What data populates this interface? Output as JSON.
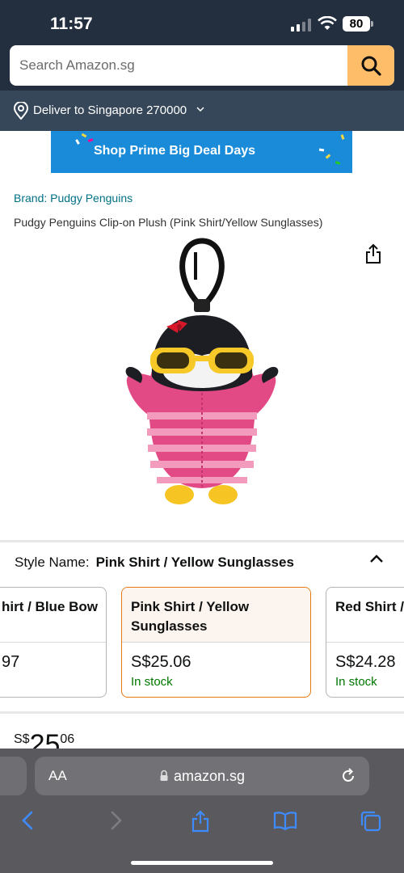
{
  "status_bar": {
    "time": "11:57",
    "battery": "80"
  },
  "search": {
    "placeholder": "Search Amazon.sg"
  },
  "delivery": {
    "text": "Deliver to Singapore 270000"
  },
  "banner": {
    "text": "Shop Prime Big Deal Days"
  },
  "product": {
    "brand": "Brand: Pudgy Penguins",
    "title": "Pudgy Penguins Clip-on Plush (Pink Shirt/Yellow Sunglasses)"
  },
  "style": {
    "label": "Style Name:",
    "selected": "Pink Shirt / Yellow Sunglasses",
    "options": [
      {
        "name": "hirt / Blue Bow",
        "price": "97",
        "stock": ""
      },
      {
        "name": "Pink Shirt / Yellow Sunglasses",
        "price": "S$25.06",
        "stock": "In stock"
      },
      {
        "name": "Red Shirt /",
        "price": "S$24.28",
        "stock": "In stock"
      }
    ]
  },
  "price_peek": {
    "currency": "S$",
    "whole": "25",
    "fraction": "06"
  },
  "browser": {
    "aa": "AA",
    "url": "amazon.sg"
  },
  "colors": {
    "header": "#232f3e",
    "delivery": "#37475a",
    "search_button": "#febd69",
    "link": "#007185",
    "in_stock": "#007600",
    "selected_border": "#e47911"
  }
}
